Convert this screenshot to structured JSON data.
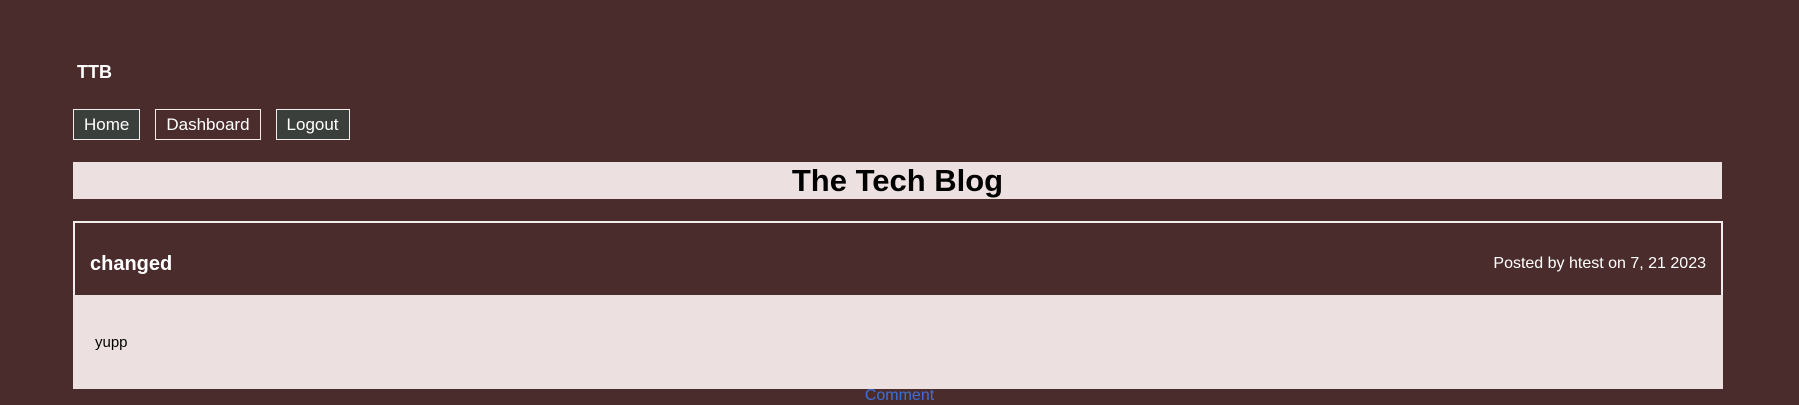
{
  "header": {
    "brand": "TTB",
    "nav": {
      "home_label": "Home",
      "dashboard_label": "Dashboard",
      "logout_label": "Logout"
    }
  },
  "banner": {
    "title": "The Tech Blog"
  },
  "post": {
    "title": "changed",
    "meta": "Posted by htest on 7, 21 2023",
    "content": "yupp",
    "comment_label": "Comment"
  },
  "colors": {
    "page_background": "#4b2c2d",
    "panel_background": "#ede0e0",
    "link": "#3d6fd9",
    "button_dark": "#3b3f3c"
  }
}
